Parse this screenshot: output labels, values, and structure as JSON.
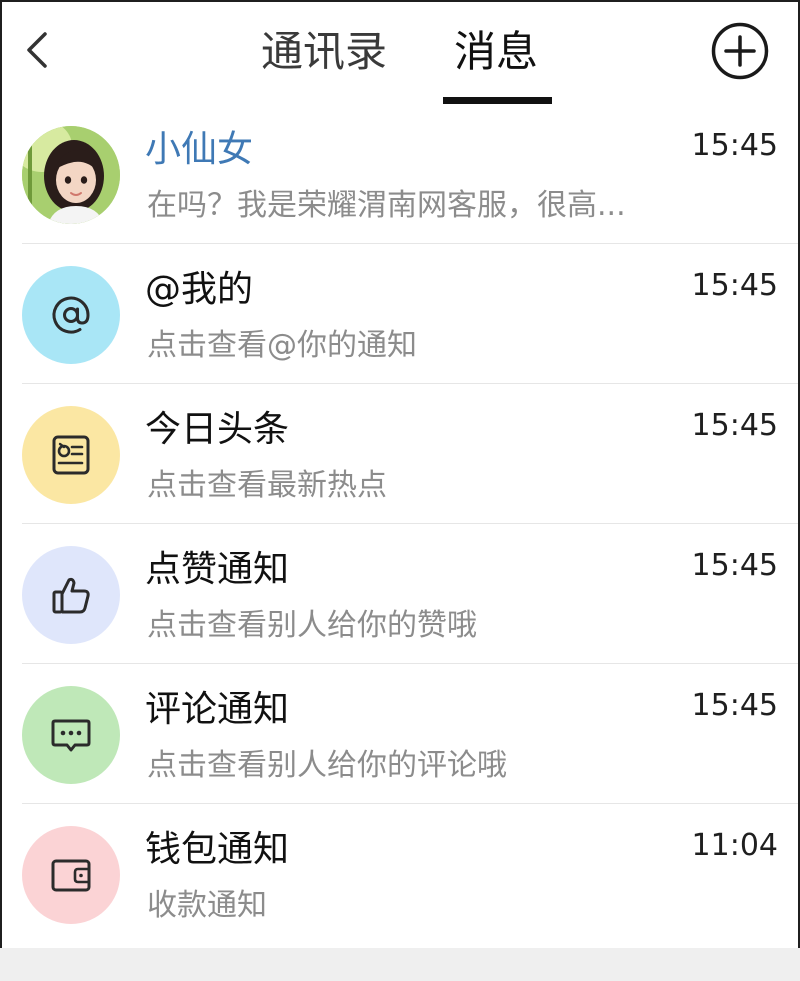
{
  "header": {
    "back_icon": "chevron-left-icon",
    "tabs": [
      {
        "label": "通讯录",
        "active": false
      },
      {
        "label": "消息",
        "active": true
      }
    ],
    "add_icon": "plus-circle-icon"
  },
  "messages": [
    {
      "title": "小仙女",
      "preview": "在吗？我是荣耀渭南网客服，很高...",
      "time": "15:45",
      "icon": "user-avatar-photo",
      "highlight": true
    },
    {
      "title": "@我的",
      "preview": "点击查看@你的通知",
      "time": "15:45",
      "icon": "at-icon",
      "color": "#a9e6f6"
    },
    {
      "title": "今日头条",
      "preview": "点击查看最新热点",
      "time": "15:45",
      "icon": "news-icon",
      "color": "#fbe7a3"
    },
    {
      "title": "点赞通知",
      "preview": "点击查看别人给你的赞哦",
      "time": "15:45",
      "icon": "thumbs-up-icon",
      "color": "#dfe6fb"
    },
    {
      "title": "评论通知",
      "preview": "点击查看别人给你的评论哦",
      "time": "15:45",
      "icon": "comment-icon",
      "color": "#bfe8b8"
    },
    {
      "title": "钱包通知",
      "preview": "收款通知",
      "time": "11:04",
      "icon": "wallet-icon",
      "color": "#fbd3d5"
    }
  ],
  "colors": {
    "highlight_name": "#3f79b5",
    "preview_text": "#8c8c8c"
  }
}
